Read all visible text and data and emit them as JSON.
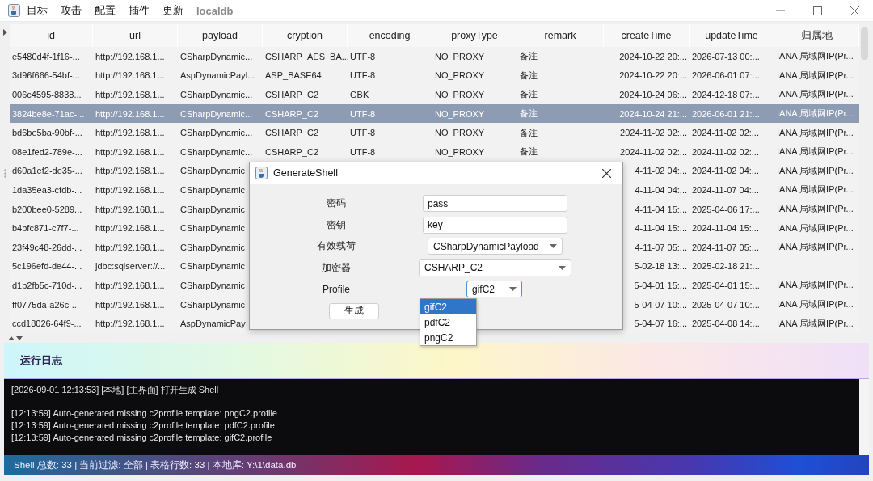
{
  "menu": {
    "items": [
      "目标",
      "攻击",
      "配置",
      "插件",
      "更新"
    ],
    "db_label": "localdb"
  },
  "table": {
    "columns": [
      "id",
      "url",
      "payload",
      "cryption",
      "encoding",
      "proxyType",
      "remark",
      "createTime",
      "updateTime",
      "归属地"
    ],
    "rows": [
      {
        "selected": false,
        "id": "e5480d4f-1f16-...",
        "url": "http://192.168.1...",
        "payload": "CSharpDynamic...",
        "cryption": "CSHARP_AES_BA...",
        "encoding": "UTF-8",
        "proxyType": "NO_PROXY",
        "remark": "备注",
        "createTime": "2024-10-22 20:...",
        "updateTime": "2026-07-13 00:...",
        "location": "IANA 局域网IP(Pr..."
      },
      {
        "selected": false,
        "id": "3d96f666-54bf-...",
        "url": "http://192.168.1...",
        "payload": "AspDynamicPayl...",
        "cryption": "ASP_BASE64",
        "encoding": "UTF-8",
        "proxyType": "NO_PROXY",
        "remark": "备注",
        "createTime": "2024-10-22 20:...",
        "updateTime": "2026-06-01 07:...",
        "location": "IANA 局域网IP(Pr..."
      },
      {
        "selected": false,
        "id": "006c4595-8838...",
        "url": "http://192.168.1...",
        "payload": "CSharpDynamic...",
        "cryption": "CSHARP_C2",
        "encoding": "GBK",
        "proxyType": "NO_PROXY",
        "remark": "备注",
        "createTime": "2024-10-24 06:...",
        "updateTime": "2024-12-18 07:...",
        "location": "IANA 局域网IP(Pr..."
      },
      {
        "selected": true,
        "id": "3824be8e-71ac-...",
        "url": "http://192.168.1...",
        "payload": "CSharpDynamic...",
        "cryption": "CSHARP_C2",
        "encoding": "UTF-8",
        "proxyType": "NO_PROXY",
        "remark": "备注",
        "createTime": "2024-10-24 21:...",
        "updateTime": "2026-06-01 21:...",
        "location": "IANA 局域网IP(Pr..."
      },
      {
        "selected": false,
        "id": "bd6be5ba-90bf-...",
        "url": "http://192.168.1...",
        "payload": "CSharpDynamic...",
        "cryption": "CSHARP_C2",
        "encoding": "UTF-8",
        "proxyType": "NO_PROXY",
        "remark": "备注",
        "createTime": "2024-11-02 02:...",
        "updateTime": "2024-11-02 02:...",
        "location": "IANA 局域网IP(Pr..."
      },
      {
        "selected": false,
        "id": "08e1fed2-789e-...",
        "url": "http://192.168.1...",
        "payload": "CSharpDynamic...",
        "cryption": "CSHARP_C2",
        "encoding": "UTF-8",
        "proxyType": "NO_PROXY",
        "remark": "备注",
        "createTime": "2024-11-02 02:...",
        "updateTime": "2024-11-02 02:...",
        "location": "IANA 局域网IP(Pr..."
      },
      {
        "selected": false,
        "id": "d60a1ef2-de35-...",
        "url": "http://192.168.1...",
        "payload": "CSharpDynamic",
        "createTime": "4-11-02 04:...",
        "updateTime": "2024-11-02 04:...",
        "location": "IANA 局域网IP(Pr..."
      },
      {
        "selected": false,
        "id": "1da35ea3-cfdb-...",
        "url": "http://192.168.1...",
        "payload": "CSharpDynamic",
        "createTime": "4-11-04 04:...",
        "updateTime": "2024-11-07 04:...",
        "location": "IANA 局域网IP(Pr..."
      },
      {
        "selected": false,
        "id": "b200bee0-5289...",
        "url": "http://192.168.1...",
        "payload": "CSharpDynamic",
        "createTime": "4-11-04 15:...",
        "updateTime": "2025-04-06 17:...",
        "location": "IANA 局域网IP(Pr..."
      },
      {
        "selected": false,
        "id": "b4bfc871-c7f7-...",
        "url": "http://192.168.1...",
        "payload": "CSharpDynamic",
        "createTime": "4-11-04 15:...",
        "updateTime": "2024-11-04 15:...",
        "location": "IANA 局域网IP(Pr..."
      },
      {
        "selected": false,
        "id": "23f49c48-26dd-...",
        "url": "http://192.168.1...",
        "payload": "CSharpDynamic",
        "createTime": "4-11-07 05:...",
        "updateTime": "2024-11-07 05:...",
        "location": "IANA 局域网IP(Pr..."
      },
      {
        "selected": false,
        "id": "5c196efd-de44-...",
        "url": "jdbc:sqlserver://...",
        "payload": "CSharpDynamic",
        "createTime": "5-02-18 13:...",
        "updateTime": "2025-02-18 21:..."
      },
      {
        "selected": false,
        "id": "d1b2fb5c-710d-...",
        "url": "http://192.168.1...",
        "payload": "CSharpDynamic",
        "createTime": "5-04-01 15:...",
        "updateTime": "2025-04-01 15:...",
        "location": "IANA 局域网IP(Pr..."
      },
      {
        "selected": false,
        "id": "ff0775da-a26c-...",
        "url": "http://192.168.1...",
        "payload": "CSharpDynamic",
        "createTime": "5-04-07 10:...",
        "updateTime": "2025-04-07 10:...",
        "location": "IANA 局域网IP(Pr..."
      },
      {
        "selected": false,
        "id": "ccd18026-64f9-...",
        "url": "http://192.168.1...",
        "payload": "AspDynamicPay",
        "createTime": "5-04-07 16:...",
        "updateTime": "2025-04-08 14:...",
        "location": "IANA 局域网IP(Pr..."
      }
    ]
  },
  "dialog": {
    "title": "GenerateShell",
    "fields": [
      {
        "kind": "text",
        "label": "密码",
        "value": "pass"
      },
      {
        "kind": "text",
        "label": "密钥",
        "value": "key"
      },
      {
        "kind": "select",
        "label": "有效载荷",
        "value": "CSharpDynamicPayload"
      },
      {
        "kind": "select",
        "label": "加密器",
        "value": "CSHARP_C2"
      },
      {
        "kind": "select",
        "label": "Profile",
        "value": "gifC2",
        "focused": true,
        "options": [
          {
            "label": "gifC2",
            "selected": true
          },
          {
            "label": "pdfC2",
            "selected": false
          },
          {
            "label": "pngC2",
            "selected": false
          }
        ]
      }
    ],
    "button": "生成"
  },
  "log": {
    "title": "运行日志",
    "groups": [
      [
        "[2026-09-01 12:13:53] [本地] [主界面] 打开生成 Shell"
      ],
      [
        "[12:13:59] Auto-generated missing c2profile template: pngC2.profile",
        "[12:13:59] Auto-generated missing c2profile template: pdfC2.profile",
        "[12:13:59] Auto-generated missing c2profile template: gifC2.profile"
      ]
    ]
  },
  "status_bar": "Shell 总数: 33 | 当前过滤: 全部 | 表格行数: 33 | 本地库: Y:\\1\\data.db"
}
